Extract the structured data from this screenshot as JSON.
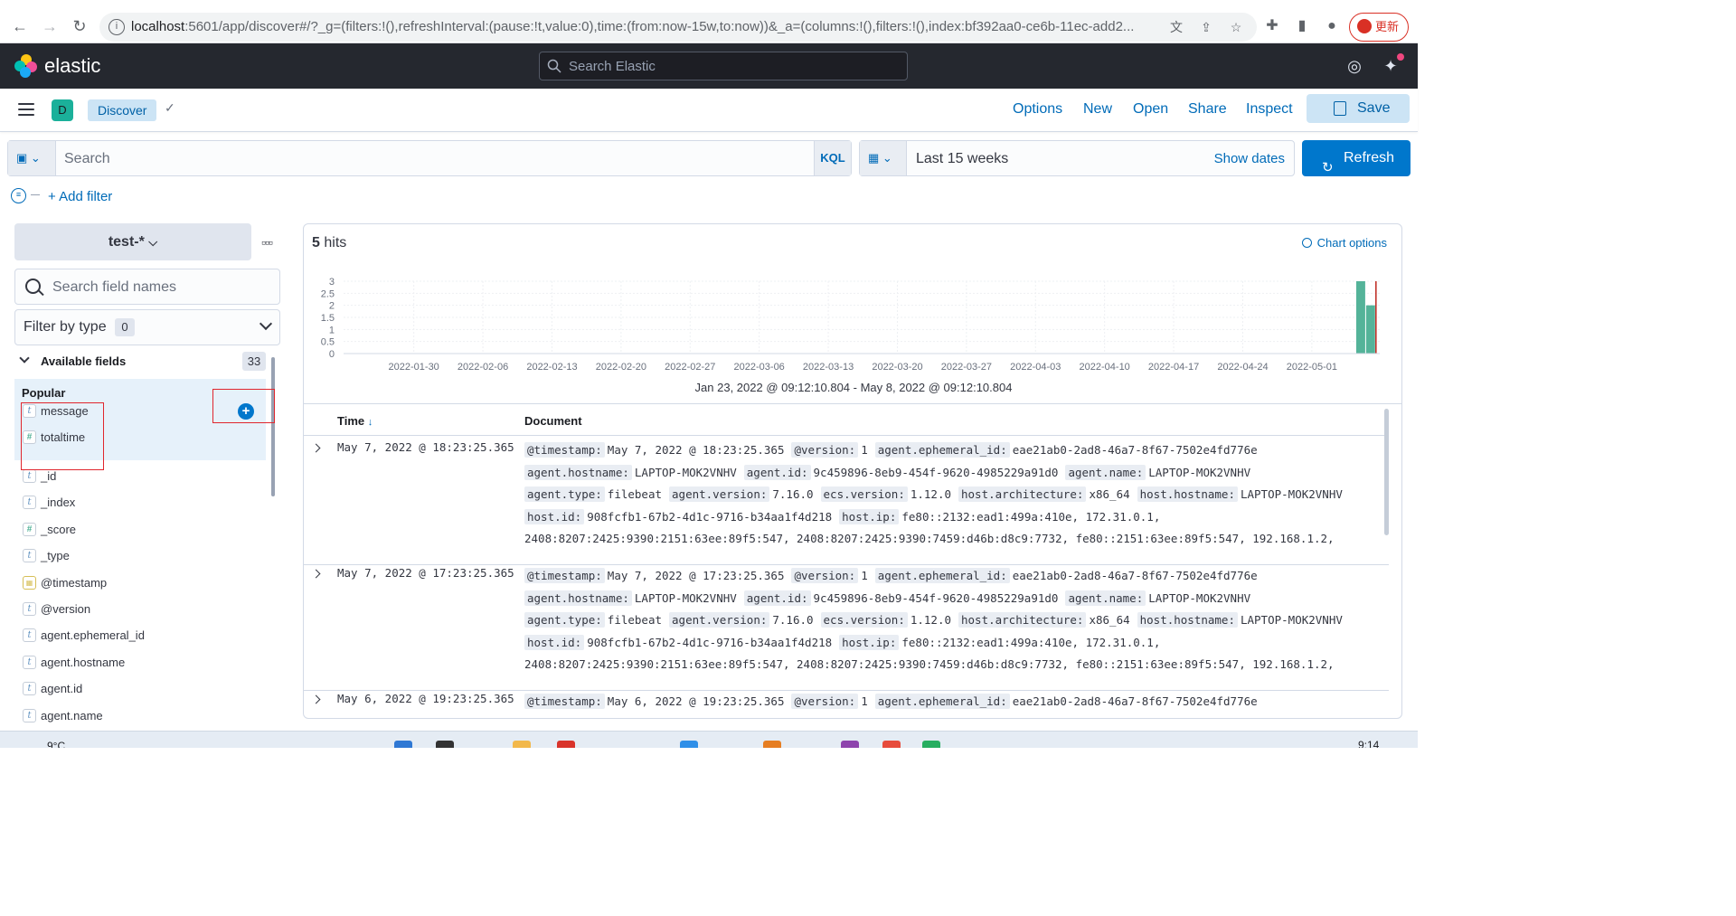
{
  "browser": {
    "url_host": "localhost",
    "url_rest": ":5601/app/discover#/?_g=(filters:!(),refreshInterval:(pause:!t,value:0),time:(from:now-15w,to:now))&_a=(columns:!(),filters:!(),index:bf392aa0-ce6b-11ec-add2...",
    "update_label": "更新"
  },
  "header": {
    "brand": "elastic",
    "search_placeholder": "Search Elastic"
  },
  "subnav": {
    "space_initial": "D",
    "breadcrumb": "Discover",
    "links": [
      "Options",
      "New",
      "Open",
      "Share",
      "Inspect"
    ],
    "save_label": "Save"
  },
  "query": {
    "placeholder": "Search",
    "language": "KQL",
    "time_range": "Last 15 weeks",
    "show_dates": "Show dates",
    "refresh_label": "Refresh",
    "add_filter": "+ Add filter"
  },
  "sidebar": {
    "index_pattern": "test-*",
    "field_search_placeholder": "Search field names",
    "filter_by_type": "Filter by type",
    "filter_count": "0",
    "available_label": "Available fields",
    "available_count": "33",
    "popular_label": "Popular",
    "popular_fields": [
      {
        "name": "message",
        "type": "t"
      },
      {
        "name": "totaltime",
        "type": "#"
      }
    ],
    "fields": [
      {
        "name": "_id",
        "type": "t"
      },
      {
        "name": "_index",
        "type": "t"
      },
      {
        "name": "_score",
        "type": "#"
      },
      {
        "name": "_type",
        "type": "t"
      },
      {
        "name": "@timestamp",
        "type": "date"
      },
      {
        "name": "@version",
        "type": "t"
      },
      {
        "name": "agent.ephemeral_id",
        "type": "t"
      },
      {
        "name": "agent.hostname",
        "type": "t"
      },
      {
        "name": "agent.id",
        "type": "t"
      },
      {
        "name": "agent.name",
        "type": "t"
      }
    ]
  },
  "results": {
    "hits_count": "5",
    "hits_label": "hits",
    "chart_options": "Chart options",
    "range_label": "Jan 23, 2022 @ 09:12:10.804 - May 8, 2022 @ 09:12:10.804",
    "col_time": "Time",
    "col_document": "Document",
    "rows": [
      {
        "time": "May 7, 2022 @ 18:23:25.365",
        "line1": [
          [
            "@timestamp:",
            "May 7, 2022 @ 18:23:25.365"
          ],
          [
            "@version:",
            "1"
          ],
          [
            "agent.ephemeral_id:",
            "eae21ab0-2ad8-46a7-8f67-7502e4fd776e"
          ]
        ],
        "line2": [
          [
            "agent.hostname:",
            "LAPTOP-MOK2VNHV"
          ],
          [
            "agent.id:",
            "9c459896-8eb9-454f-9620-4985229a91d0"
          ],
          [
            "agent.name:",
            "LAPTOP-MOK2VNHV"
          ]
        ],
        "line3": [
          [
            "agent.type:",
            "filebeat"
          ],
          [
            "agent.version:",
            "7.16.0"
          ],
          [
            "ecs.version:",
            "1.12.0"
          ],
          [
            "host.architecture:",
            "x86_64"
          ],
          [
            "host.hostname:",
            "LAPTOP-MOK2VNHV"
          ]
        ],
        "line4": [
          [
            "host.id:",
            "908fcfb1-67b2-4d1c-9716-b34aa1f4d218"
          ],
          [
            "host.ip:",
            "fe80::2132:ead1:499a:410e, 172.31.0.1,"
          ]
        ],
        "line5": "2408:8207:2425:9390:2151:63ee:89f5:547, 2408:8207:2425:9390:7459:d46b:d8c9:7732, fe80::2151:63ee:89f5:547, 192.168.1.2,"
      },
      {
        "time": "May 7, 2022 @ 17:23:25.365",
        "line1": [
          [
            "@timestamp:",
            "May 7, 2022 @ 17:23:25.365"
          ],
          [
            "@version:",
            "1"
          ],
          [
            "agent.ephemeral_id:",
            "eae21ab0-2ad8-46a7-8f67-7502e4fd776e"
          ]
        ],
        "line2": [
          [
            "agent.hostname:",
            "LAPTOP-MOK2VNHV"
          ],
          [
            "agent.id:",
            "9c459896-8eb9-454f-9620-4985229a91d0"
          ],
          [
            "agent.name:",
            "LAPTOP-MOK2VNHV"
          ]
        ],
        "line3": [
          [
            "agent.type:",
            "filebeat"
          ],
          [
            "agent.version:",
            "7.16.0"
          ],
          [
            "ecs.version:",
            "1.12.0"
          ],
          [
            "host.architecture:",
            "x86_64"
          ],
          [
            "host.hostname:",
            "LAPTOP-MOK2VNHV"
          ]
        ],
        "line4": [
          [
            "host.id:",
            "908fcfb1-67b2-4d1c-9716-b34aa1f4d218"
          ],
          [
            "host.ip:",
            "fe80::2132:ead1:499a:410e, 172.31.0.1,"
          ]
        ],
        "line5": "2408:8207:2425:9390:2151:63ee:89f5:547, 2408:8207:2425:9390:7459:d46b:d8c9:7732, fe80::2151:63ee:89f5:547, 192.168.1.2,"
      },
      {
        "time": "May 6, 2022 @ 19:23:25.365",
        "line1": [
          [
            "@timestamp:",
            "May 6, 2022 @ 19:23:25.365"
          ],
          [
            "@version:",
            "1"
          ],
          [
            "agent.ephemeral_id:",
            "eae21ab0-2ad8-46a7-8f67-7502e4fd776e"
          ]
        ]
      }
    ]
  },
  "chart_data": {
    "type": "bar",
    "x_ticks": [
      "2022-01-30",
      "2022-02-06",
      "2022-02-13",
      "2022-02-20",
      "2022-02-27",
      "2022-03-06",
      "2022-03-13",
      "2022-03-20",
      "2022-03-27",
      "2022-04-03",
      "2022-04-10",
      "2022-04-17",
      "2022-04-24",
      "2022-05-01"
    ],
    "y_ticks": [
      "3",
      "2.5",
      "2",
      "1.5",
      "1",
      "0.5",
      "0"
    ],
    "ylim": [
      0,
      3
    ],
    "bars": [
      {
        "x": "2022-05-06",
        "value": 3
      },
      {
        "x": "2022-05-07",
        "value": 2
      }
    ],
    "now_marker": "2022-05-08",
    "grid": true
  },
  "taskbar": {
    "weather": "9°C",
    "clock": "9:14"
  }
}
